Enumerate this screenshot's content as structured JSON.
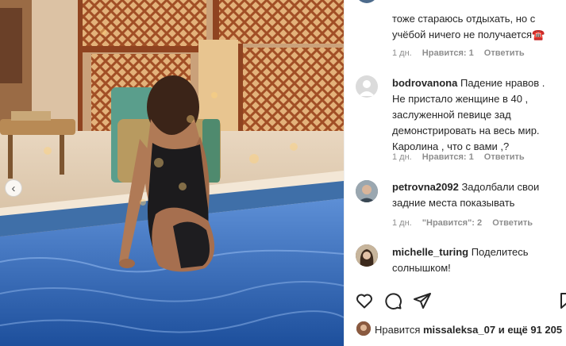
{
  "post": {
    "carousel_prev_glyph": "‹"
  },
  "comments": [
    {
      "text": "тоже стараюсь отдыхать, но с учёбой ничего не получается☎️",
      "time": "1 дн.",
      "likes": "Нравится: 1",
      "reply": "Ответить"
    },
    {
      "username": "bodrovanona",
      "text": "Падение нравов . Не пристало женщине в 40 , заслуженной певице зад демонстрировать на весь мир. Каролина , что с вами ,?",
      "time": "1 дн.",
      "likes": "Нравится: 1",
      "reply": "Ответить"
    },
    {
      "username": "petrovna2092",
      "text": "Задолбали свои задние места показывать",
      "time": "1 дн.",
      "likes": "\"Нравится\": 2",
      "reply": "Ответить"
    },
    {
      "username": "michelle_turing",
      "text": "Поделитесь солнышком!"
    }
  ],
  "actions": {
    "like_icon": "heart-icon",
    "comment_icon": "comment-icon",
    "share_icon": "send-icon",
    "save_icon": "bookmark-icon"
  },
  "likes": {
    "prefix": "Нравится",
    "user": "missaleksa_07",
    "suffix": "и ещё 91 205"
  },
  "colors": {
    "text": "#262626",
    "muted": "#8e8e8e",
    "border": "#efefef",
    "pool": "#2f6fc4",
    "wood": "#a5562b"
  }
}
